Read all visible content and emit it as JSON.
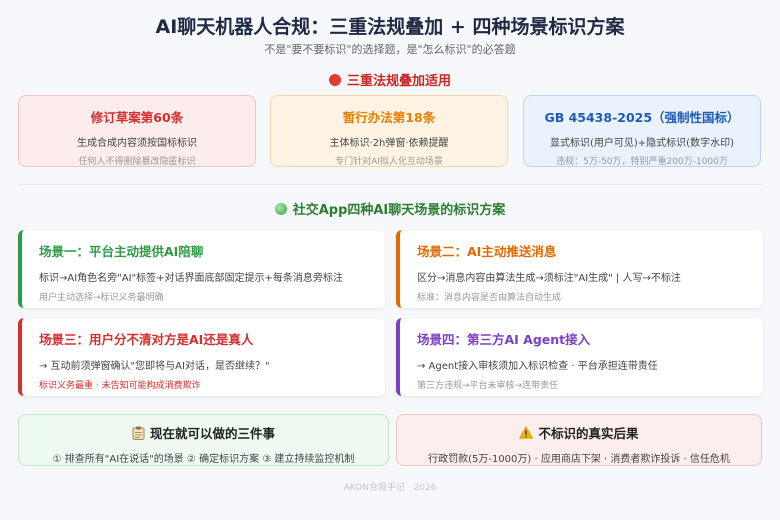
{
  "title": "AI聊天机器人合规：三重法规叠加 + 四种场景标识方案",
  "subtitle": "不是\"要不要标识\"的选择题，是\"怎么标识\"的必答题",
  "section1": {
    "label": "三重法规叠加适用",
    "dot_color": "#e53935"
  },
  "laws": [
    {
      "title": "修订草案第60条",
      "desc": "生成合成内容须按国标标识",
      "sub": "任何人不得删除篡改隐匿标识",
      "color": "#d32f2f",
      "bg": "#fdecec",
      "border": "#f3c2c2"
    },
    {
      "title": "暂行办法第18条",
      "desc": "主体标识·2h弹窗·依赖提醒",
      "sub": "专门针对AI拟人化互动场景",
      "color": "#e67e00",
      "bg": "#fff4e3",
      "border": "#f6d7a5"
    },
    {
      "title": "GB 45438-2025（强制性国标）",
      "desc": "显式标识(用户可见)+隐式标识(数字水印)",
      "sub": "违规：5万-50万，特别严重200万-1000万",
      "color": "#1e5bb5",
      "bg": "#eaf2fd",
      "border": "#bcd4f3"
    }
  ],
  "section2": {
    "label": "社交App四种AI聊天场景的标识方案",
    "dot_color": "#43a047"
  },
  "scenes": [
    {
      "title": "场景一：平台主动提供AI陪聊",
      "desc": "标识→AI角色名旁\"AI\"标签+对话界面底部固定提示+每条消息旁标注",
      "sub": "用户主动选择→标识义务最明确",
      "color": "#2e9a46",
      "sub_color": "#999999"
    },
    {
      "title": "场景二：AI主动推送消息",
      "desc": "区分→消息内容由算法生成→须标注\"AI生成\" | 人写→不标注",
      "sub": "标准：消息内容是否由算法自动生成",
      "color": "#e06a00",
      "sub_color": "#999999"
    },
    {
      "title": "场景三：用户分不清对方是AI还是真人",
      "desc": "→ 互动前须弹窗确认\"您即将与AI对话，是否继续？\"",
      "sub": "标识义务最重 · 未告知可能构成消费欺诈",
      "color": "#d32f2f",
      "sub_color": "#d32f2f"
    },
    {
      "title": "场景四：第三方AI Agent接入",
      "desc": "→ Agent接入审核须加入标识检查 · 平台承担连带责任",
      "sub": "第三方违规→平台未审核→连带责任",
      "color": "#7b3fc4",
      "sub_color": "#999999"
    }
  ],
  "actions": {
    "icon": "clipboard-icon",
    "title": "现在就可以做的三件事",
    "desc": "① 排查所有\"AI在说话\"的场景 ② 确定标识方案 ③ 建立持续监控机制",
    "bg": "#eefaf1",
    "border": "#bfe6c9"
  },
  "consequences": {
    "icon": "warning-icon",
    "title": "不标识的真实后果",
    "desc": "行政罚款(5万-1000万) · 应用商店下架 · 消费者欺诈投诉 · 信任危机",
    "bg": "#fdeeee",
    "border": "#f3c6c6"
  },
  "footer": "AKON合规手记 · 2026"
}
